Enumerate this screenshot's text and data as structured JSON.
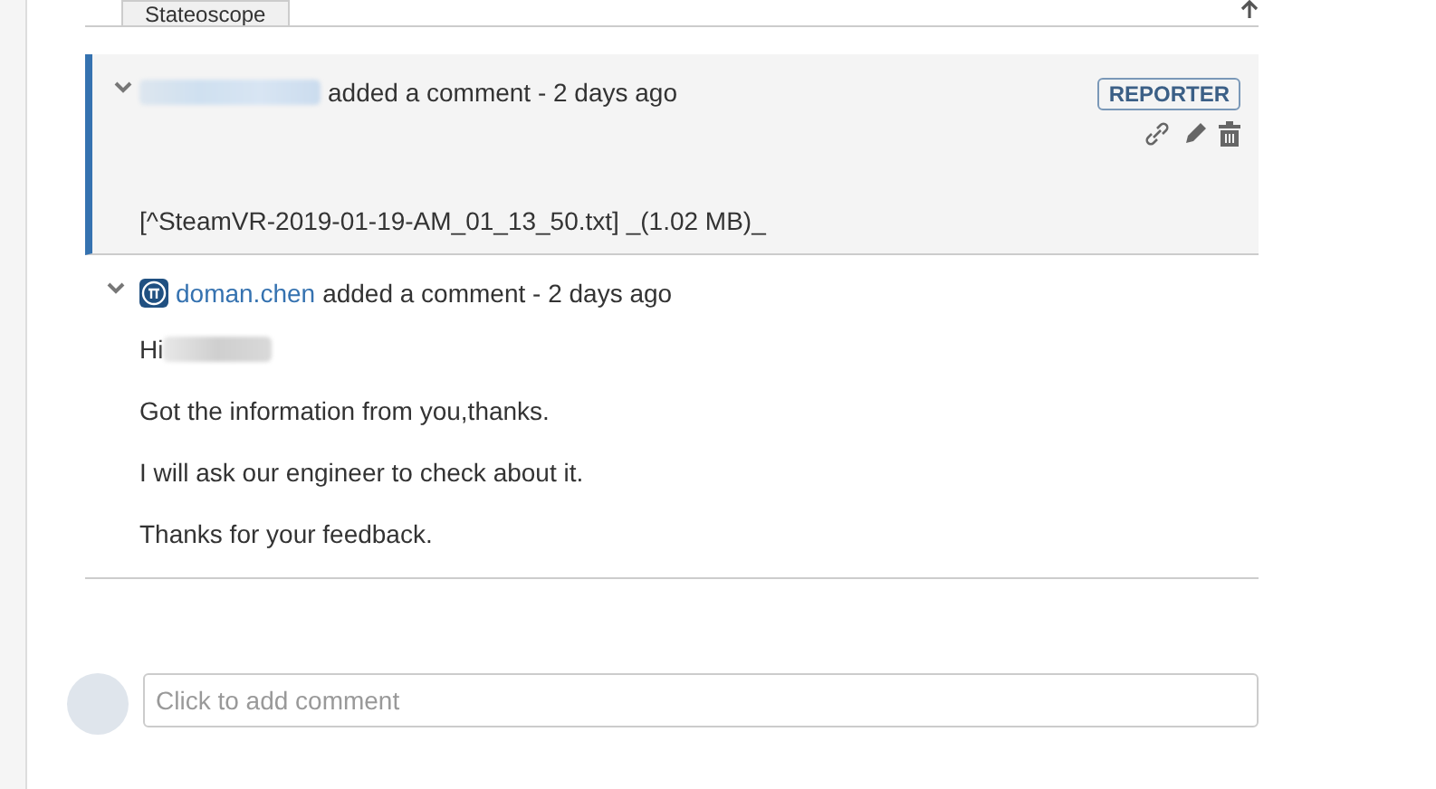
{
  "tabs": [
    {
      "label": "Stateoscope",
      "selected": false
    }
  ],
  "comments": [
    {
      "author_redacted": true,
      "action": "added a comment - 2 days ago",
      "badge": "REPORTER",
      "highlighted": true,
      "expanded": true,
      "body": [
        "[^SteamVR-2019-01-19-AM_01_13_50.txt] _(1.02 MB)_"
      ]
    },
    {
      "author": "doman.chen",
      "author_redacted": false,
      "action": "added a comment - 2 days ago",
      "highlighted": false,
      "expanded": true,
      "greeting": "Hi",
      "body": [
        "Got the information from you,thanks.",
        "I will ask our engineer to check about it.",
        "Thanks for your feedback."
      ]
    }
  ],
  "comment_field": {
    "placeholder": "Click to add comment"
  }
}
